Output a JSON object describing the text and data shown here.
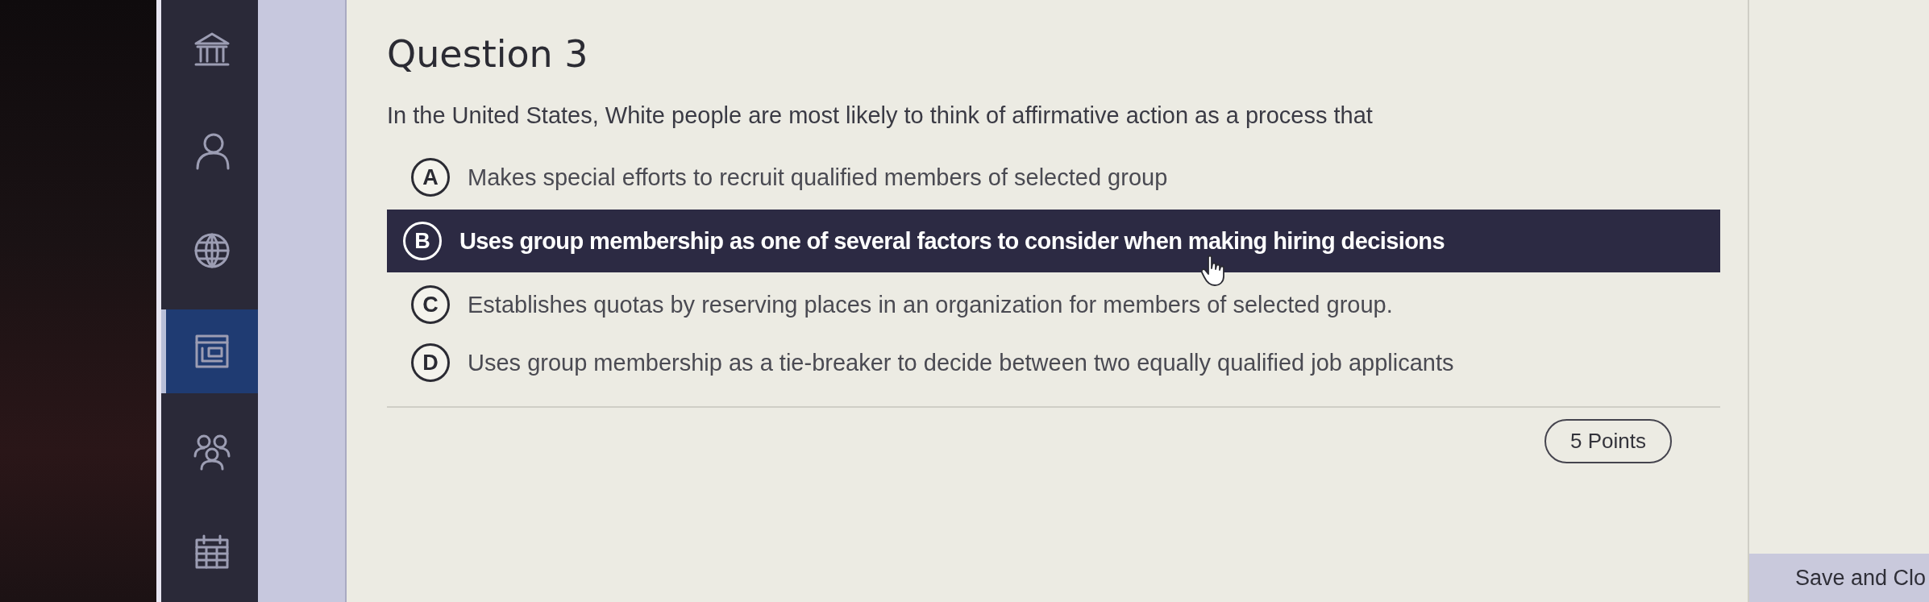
{
  "sidebar": {
    "items": [
      {
        "selected": false
      },
      {
        "selected": false
      },
      {
        "selected": false
      },
      {
        "selected": true
      },
      {
        "selected": false
      },
      {
        "selected": false
      }
    ]
  },
  "question": {
    "title": "Question 3",
    "prompt": "In the United States, White people are most likely to think of affirmative action as a process that",
    "options": [
      {
        "letter": "A",
        "text": "Makes special efforts to recruit qualified members of selected group",
        "selected": false
      },
      {
        "letter": "B",
        "text": "Uses group membership as one of several factors to consider when making hiring decisions",
        "selected": true
      },
      {
        "letter": "C",
        "text": "Establishes quotas by reserving places in an organization for members of selected group.",
        "selected": false
      },
      {
        "letter": "D",
        "text": "Uses group membership as a tie-breaker to decide between two equally qualified job applicants",
        "selected": false
      }
    ],
    "points": "5 Points"
  },
  "footer": {
    "save_button": "Save and Clo"
  }
}
